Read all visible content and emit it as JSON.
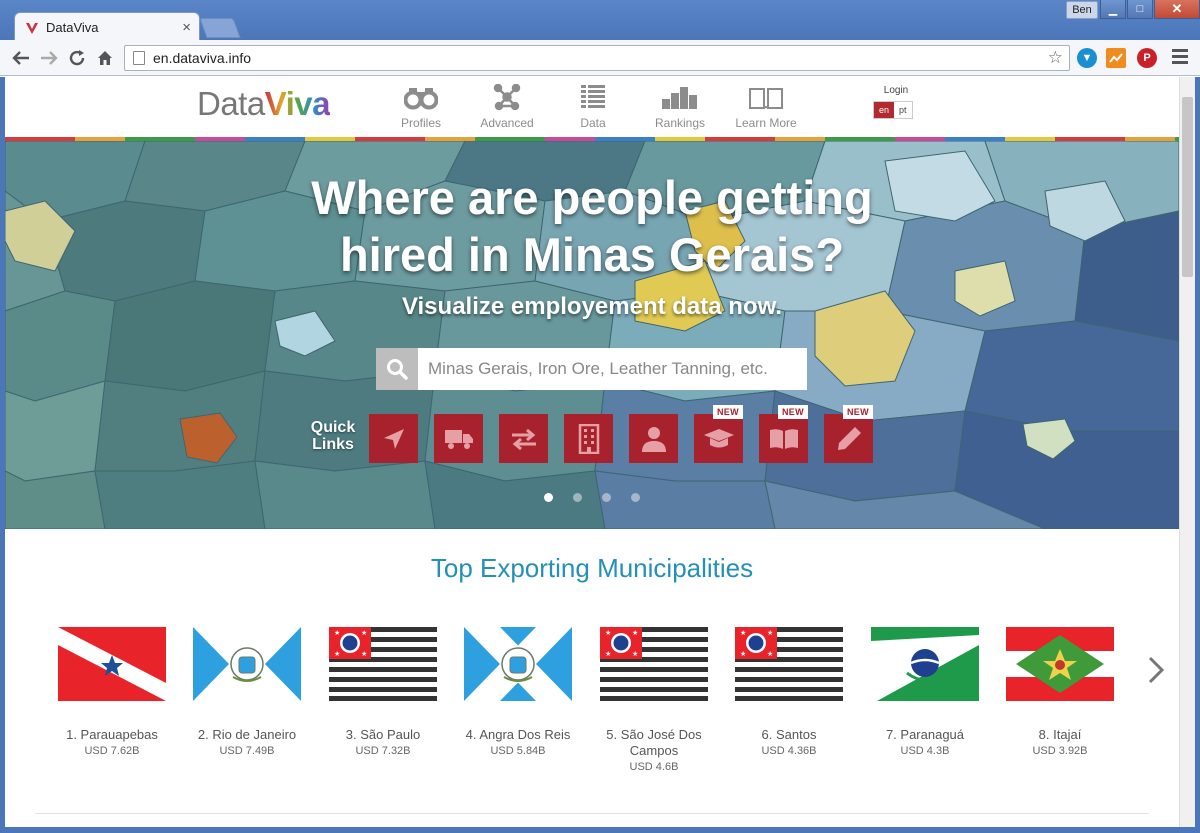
{
  "browser": {
    "tab_title": "DataViva",
    "tab_close": "×",
    "url": "en.dataviva.info",
    "user": "Ben",
    "controls": {
      "minimize": "▁",
      "maximize": "□",
      "close": "✕"
    }
  },
  "site": {
    "logo_left": "Data",
    "logo_right": "Viva",
    "nav": [
      {
        "label": "Profiles",
        "icon": "binoculars-icon"
      },
      {
        "label": "Advanced",
        "icon": "network-icon"
      },
      {
        "label": "Data",
        "icon": "table-icon"
      },
      {
        "label": "Rankings",
        "icon": "rankings-icon"
      },
      {
        "label": "Learn More",
        "icon": "book-icon"
      }
    ],
    "login": "Login",
    "lang_en": "en",
    "lang_pt": "pt"
  },
  "hero": {
    "title_line1": "Where are people getting",
    "title_line2": "hired in Minas Gerais?",
    "subtitle": "Visualize employement data now.",
    "search_placeholder": "Minas Gerais, Iron Ore, Leather Tanning, etc.",
    "quick_links_line1": "Quick",
    "quick_links_line2": "Links",
    "new_badge": "NEW",
    "quick_links": [
      {
        "icon": "location-arrow-icon",
        "new": false
      },
      {
        "icon": "truck-icon",
        "new": false
      },
      {
        "icon": "exchange-icon",
        "new": false
      },
      {
        "icon": "building-icon",
        "new": false
      },
      {
        "icon": "person-icon",
        "new": false
      },
      {
        "icon": "graduation-cap-icon",
        "new": true
      },
      {
        "icon": "open-book-icon",
        "new": true
      },
      {
        "icon": "pencil-icon",
        "new": true
      }
    ],
    "slides": 4,
    "active_slide": 0,
    "colors": {
      "quick_link": "#a7222d",
      "map_base": "#4f7c84",
      "highlight_orange": "#c2602a",
      "highlight_yellow": "#e8cf52"
    }
  },
  "exports": {
    "title": "Top Exporting Municipalities",
    "items": [
      {
        "name": "1. Parauapebas",
        "value": "USD 7.62B",
        "flag": "para"
      },
      {
        "name": "2. Rio de Janeiro",
        "value": "USD 7.49B",
        "flag": "rj"
      },
      {
        "name": "3. São Paulo",
        "value": "USD 7.32B",
        "flag": "sp"
      },
      {
        "name": "4. Angra Dos Reis",
        "value": "USD 5.84B",
        "flag": "rj"
      },
      {
        "name": "5. São José Dos Campos",
        "value": "USD 4.6B",
        "flag": "sp"
      },
      {
        "name": "6. Santos",
        "value": "USD 4.36B",
        "flag": "sp"
      },
      {
        "name": "7. Paranaguá",
        "value": "USD 4.3B",
        "flag": "pr"
      },
      {
        "name": "8. Itajaí",
        "value": "USD 3.92B",
        "flag": "sc"
      }
    ]
  }
}
